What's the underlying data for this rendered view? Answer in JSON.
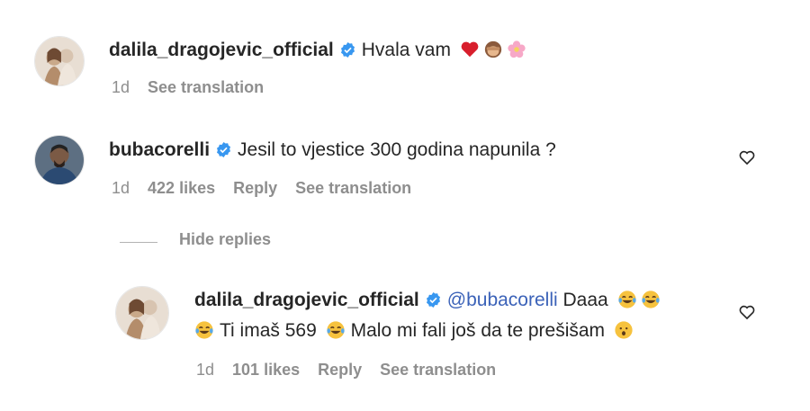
{
  "comments": [
    {
      "username": "dalila_dragojevic_official",
      "text": "Hvala vam",
      "emojis": [
        "red-heart",
        "see-no-evil-monkey",
        "cherry-blossom"
      ],
      "time": "1d",
      "see_translation": "See translation"
    },
    {
      "username": "bubacorelli",
      "text": "Jesil to vjestice 300 godina napunila ?",
      "time": "1d",
      "likes": "422 likes",
      "reply": "Reply",
      "see_translation": "See translation"
    }
  ],
  "hide_replies": "Hide replies",
  "reply_comment": {
    "username": "dalila_dragojevic_official",
    "mention": "@bubacorelli",
    "text_a": "Daaa",
    "text_b": "Ti imaš 569",
    "text_c": "Malo mi fali još da te prešišam",
    "emojis": [
      "face-with-tears-of-joy",
      "hushed-face"
    ],
    "time": "1d",
    "likes": "101 likes",
    "reply": "Reply",
    "see_translation": "See translation"
  },
  "colors": {
    "verified": "#3897f0",
    "mention": "#3b62b8",
    "meta": "#8e8e8e"
  }
}
